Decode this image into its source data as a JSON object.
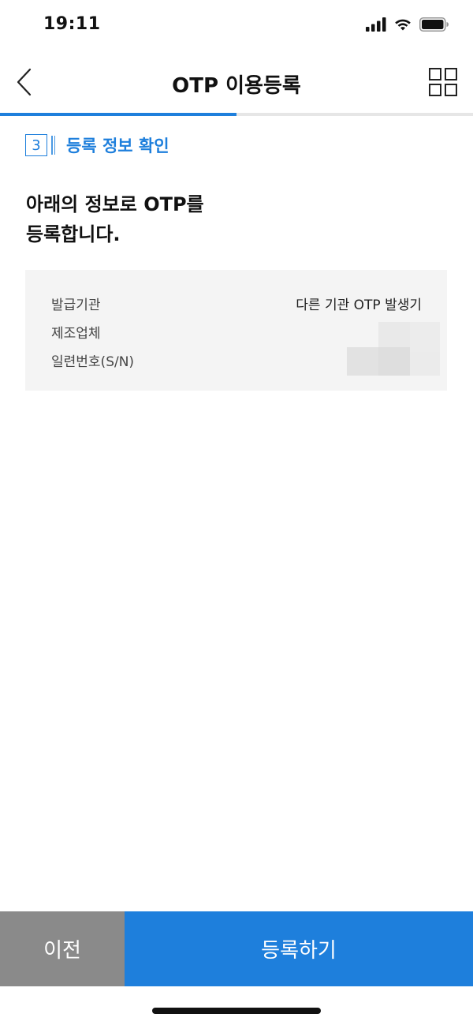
{
  "status_bar": {
    "time": "19:11",
    "icons": [
      "signal-icon",
      "wifi-icon",
      "battery-icon"
    ]
  },
  "header": {
    "title": "OTP 이용등록",
    "back_icon": "chevron-left-icon",
    "menu_icon": "grid-menu-icon"
  },
  "progress": {
    "fraction": 0.5,
    "color": "#1e7fdc"
  },
  "step": {
    "number": "3",
    "label": "등록 정보 확인"
  },
  "headline": {
    "line1": "아래의 정보로 OTP를",
    "line2": "등록합니다."
  },
  "info": {
    "rows": [
      {
        "label": "발급기관",
        "value": "다른 기관 OTP 발생기"
      },
      {
        "label": "제조업체",
        "value": ""
      },
      {
        "label": "일련번호(S/N)",
        "value": ""
      }
    ]
  },
  "buttons": {
    "prev_label": "이전",
    "register_label": "등록하기"
  },
  "colors": {
    "accent": "#1e7fdc",
    "secondary_button": "#8a8a8a",
    "card_background": "#f4f4f4"
  }
}
